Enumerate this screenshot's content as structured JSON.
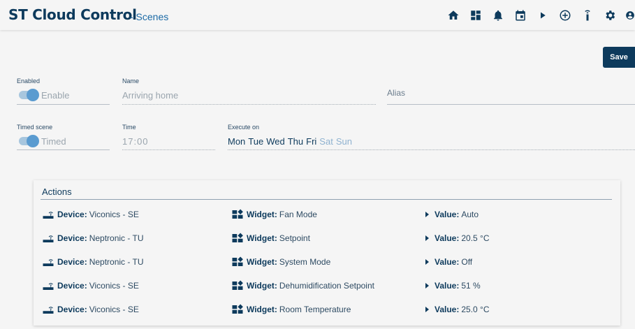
{
  "header": {
    "brand": "ST Cloud Control",
    "subtitle": "- Scenes",
    "nav_icons": [
      "home-icon",
      "dashboard-icon",
      "bell-icon",
      "calendar-icon",
      "play-icon",
      "add-circle-icon",
      "remote-icon",
      "settings-icon",
      "account-icon"
    ]
  },
  "toolbar": {
    "save_label": "Save"
  },
  "form": {
    "enabled_label": "Enabled",
    "enabled_text": "Enable",
    "name_label": "Name",
    "name_value": "Arriving home",
    "alias_label": "Alias",
    "timed_label": "Timed scene",
    "timed_text": "Timed",
    "time_label": "Time",
    "time_value": "17:00",
    "execute_label": "Execute on",
    "days": [
      {
        "label": "Mon",
        "active": true
      },
      {
        "label": "Tue",
        "active": true
      },
      {
        "label": "Wed",
        "active": true
      },
      {
        "label": "Thu",
        "active": true
      },
      {
        "label": "Fri",
        "active": true
      },
      {
        "label": "Sat",
        "active": false
      },
      {
        "label": "Sun",
        "active": false
      }
    ]
  },
  "actions": {
    "title": "Actions",
    "device_label": "Device:",
    "widget_label": "Widget:",
    "value_label": "Value:",
    "rows": [
      {
        "device": "Viconics - SE",
        "widget": "Fan Mode",
        "value": "Auto"
      },
      {
        "device": "Neptronic - TU",
        "widget": "Setpoint",
        "value": "20.5 °C"
      },
      {
        "device": "Neptronic - TU",
        "widget": "System Mode",
        "value": "Off"
      },
      {
        "device": "Viconics - SE",
        "widget": "Dehumidification Setpoint",
        "value": "51 %"
      },
      {
        "device": "Viconics - SE",
        "widget": "Room Temperature",
        "value": "25.0 °C"
      }
    ]
  },
  "colors": {
    "primary": "#0d3a5c",
    "accent": "#1c6aa6",
    "toggle_knob": "#5a9bd0"
  }
}
